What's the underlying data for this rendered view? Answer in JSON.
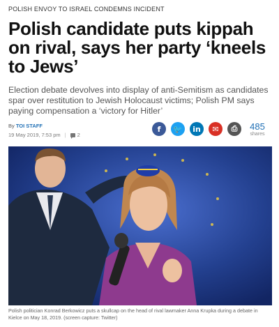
{
  "article": {
    "kicker": "POLISH ENVOY TO ISRAEL CONDEMNS INCIDENT",
    "headline": "Polish candidate puts kippah on rival, says her party ‘kneels to Jews’",
    "subhead": "Election debate devolves into display of anti-Semitism as candidates spar over restitution to Jewish Holocaust victims; Polish PM says paying compensation a ‘victory for Hitler’",
    "byline_prefix": "By",
    "author": "TOI STAFF",
    "date": "19 May 2019, 7:53 pm",
    "comment_count": "2",
    "caption": "Polish politician Konrad Berkowicz puts a skullcap on the head of rival lawmaker Anna Krupka during a debate in Kielce on May 18, 2019. (screen capture: Twitter)"
  },
  "share": {
    "buttons": [
      {
        "name": "facebook-icon",
        "glyph": "f",
        "color": "#3b5998"
      },
      {
        "name": "twitter-icon",
        "glyph": "🐦",
        "color": "#1da1f2"
      },
      {
        "name": "linkedin-icon",
        "glyph": "in",
        "color": "#0077b5"
      },
      {
        "name": "email-icon",
        "glyph": "✉",
        "color": "#d93025"
      },
      {
        "name": "print-icon",
        "glyph": "⎙",
        "color": "#555555"
      }
    ],
    "count": "485",
    "count_label": "shares"
  }
}
